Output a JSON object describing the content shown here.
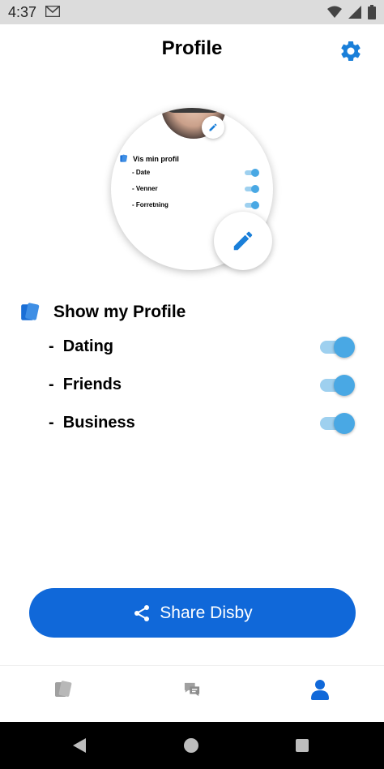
{
  "status_bar": {
    "time": "4:37"
  },
  "header": {
    "title": "Profile"
  },
  "preview": {
    "heading": "Vis min profil",
    "rows": [
      "Date",
      "Venner",
      "Forretning"
    ]
  },
  "profile_section": {
    "title": "Show my Profile",
    "rows": [
      {
        "label": "Dating",
        "enabled": true
      },
      {
        "label": "Friends",
        "enabled": true
      },
      {
        "label": "Business",
        "enabled": true
      }
    ]
  },
  "share_button": {
    "label": "Share Disby"
  },
  "bottom_nav": {
    "items": [
      {
        "icon": "cards-icon",
        "active": false
      },
      {
        "icon": "chat-icon",
        "active": false
      },
      {
        "icon": "person-icon",
        "active": true
      }
    ]
  },
  "colors": {
    "accent": "#1068d9",
    "toggle_thumb": "#49a8e4",
    "toggle_track": "#9ed0ef",
    "icon_inactive": "#a0a0a0"
  }
}
